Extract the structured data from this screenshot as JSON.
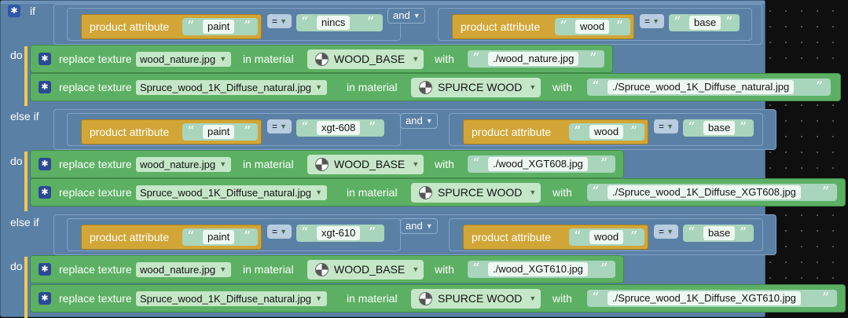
{
  "keywords": {
    "if": "if",
    "do": "do",
    "else_if": "else if",
    "and": "and",
    "with": "with",
    "replace_texture": "replace texture",
    "in_material": "in material",
    "product_attribute": "product attribute"
  },
  "operators": {
    "eq": "="
  },
  "icons": {
    "gear": "gear-icon",
    "dropdown": "chevron-down-icon",
    "material": "material-sphere-icon"
  },
  "colors": {
    "logic": "#5b80a5",
    "attribute": "#d1a637",
    "action": "#5cb063",
    "text_block": "#a8d5bc"
  },
  "branches": [
    {
      "keyword": "if",
      "conditions": [
        {
          "attribute": "paint",
          "op": "=",
          "value": "nincs"
        },
        {
          "attribute": "wood",
          "op": "=",
          "value": "base"
        }
      ],
      "actions": [
        {
          "texture": "wood_nature.jpg",
          "material": "WOOD_BASE",
          "with": "./wood_nature.jpg"
        },
        {
          "texture": "Spruce_wood_1K_Diffuse_natural.jpg",
          "material": "SPURCE WOOD",
          "with": "./Spruce_wood_1K_Diffuse_natural.jpg"
        }
      ]
    },
    {
      "keyword": "else if",
      "conditions": [
        {
          "attribute": "paint",
          "op": "=",
          "value": "xgt-608"
        },
        {
          "attribute": "wood",
          "op": "=",
          "value": "base"
        }
      ],
      "actions": [
        {
          "texture": "wood_nature.jpg",
          "material": "WOOD_BASE",
          "with": "./wood_XGT608.jpg"
        },
        {
          "texture": "Spruce_wood_1K_Diffuse_natural.jpg",
          "material": "SPURCE WOOD",
          "with": "./Spruce_wood_1K_Diffuse_XGT608.jpg"
        }
      ]
    },
    {
      "keyword": "else if",
      "conditions": [
        {
          "attribute": "paint",
          "op": "=",
          "value": "xgt-610"
        },
        {
          "attribute": "wood",
          "op": "=",
          "value": "base"
        }
      ],
      "actions": [
        {
          "texture": "wood_nature.jpg",
          "material": "WOOD_BASE",
          "with": "./wood_XGT610.jpg"
        },
        {
          "texture": "Spruce_wood_1K_Diffuse_natural.jpg",
          "material": "SPURCE WOOD",
          "with": "./Spruce_wood_1K_Diffuse_XGT610.jpg"
        }
      ]
    }
  ]
}
